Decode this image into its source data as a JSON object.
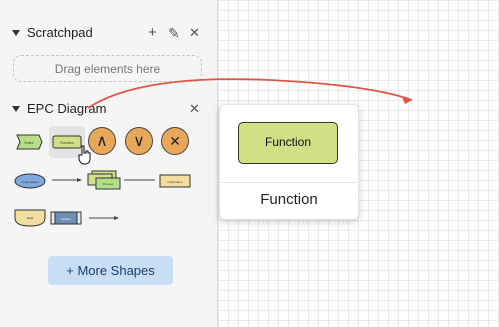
{
  "sidebar": {
    "scratchpad": {
      "title": "Scratchpad",
      "add_label": "+",
      "edit_label": "✎",
      "close_label": "✕",
      "drop_placeholder": "Drag elements here"
    },
    "epc": {
      "title": "EPC Diagram",
      "close_label": "✕",
      "shapes": [
        {
          "name": "event",
          "label": "Event"
        },
        {
          "name": "function",
          "label": "Function"
        },
        {
          "name": "and-connector",
          "label": "∧"
        },
        {
          "name": "or-connector",
          "label": "∨"
        },
        {
          "name": "xor-connector",
          "label": "✕"
        },
        {
          "name": "organisation",
          "label": "Organisation"
        },
        {
          "name": "control-flow",
          "label": ""
        },
        {
          "name": "process-path",
          "label": "Process"
        },
        {
          "name": "information-flow",
          "label": ""
        },
        {
          "name": "information-material",
          "label": "Information"
        },
        {
          "name": "data",
          "label": "Data"
        },
        {
          "name": "system",
          "label": "System"
        },
        {
          "name": "connection",
          "label": ""
        }
      ]
    },
    "more_shapes_label": "+ More Shapes"
  },
  "tooltip": {
    "preview_label": "Function",
    "title": "Function"
  },
  "colors": {
    "event": "#b5df87",
    "function": "#cfe085",
    "connector": "#e8a85a",
    "organisation": "#7fa8db",
    "information": "#f2dea0",
    "system": "#6b8fb5",
    "arrow": "#e05548",
    "more_shapes_bg": "#c8def5"
  },
  "icons": [
    "chevron-down-icon",
    "plus-icon",
    "pencil-icon",
    "close-icon",
    "hand-cursor-icon"
  ]
}
